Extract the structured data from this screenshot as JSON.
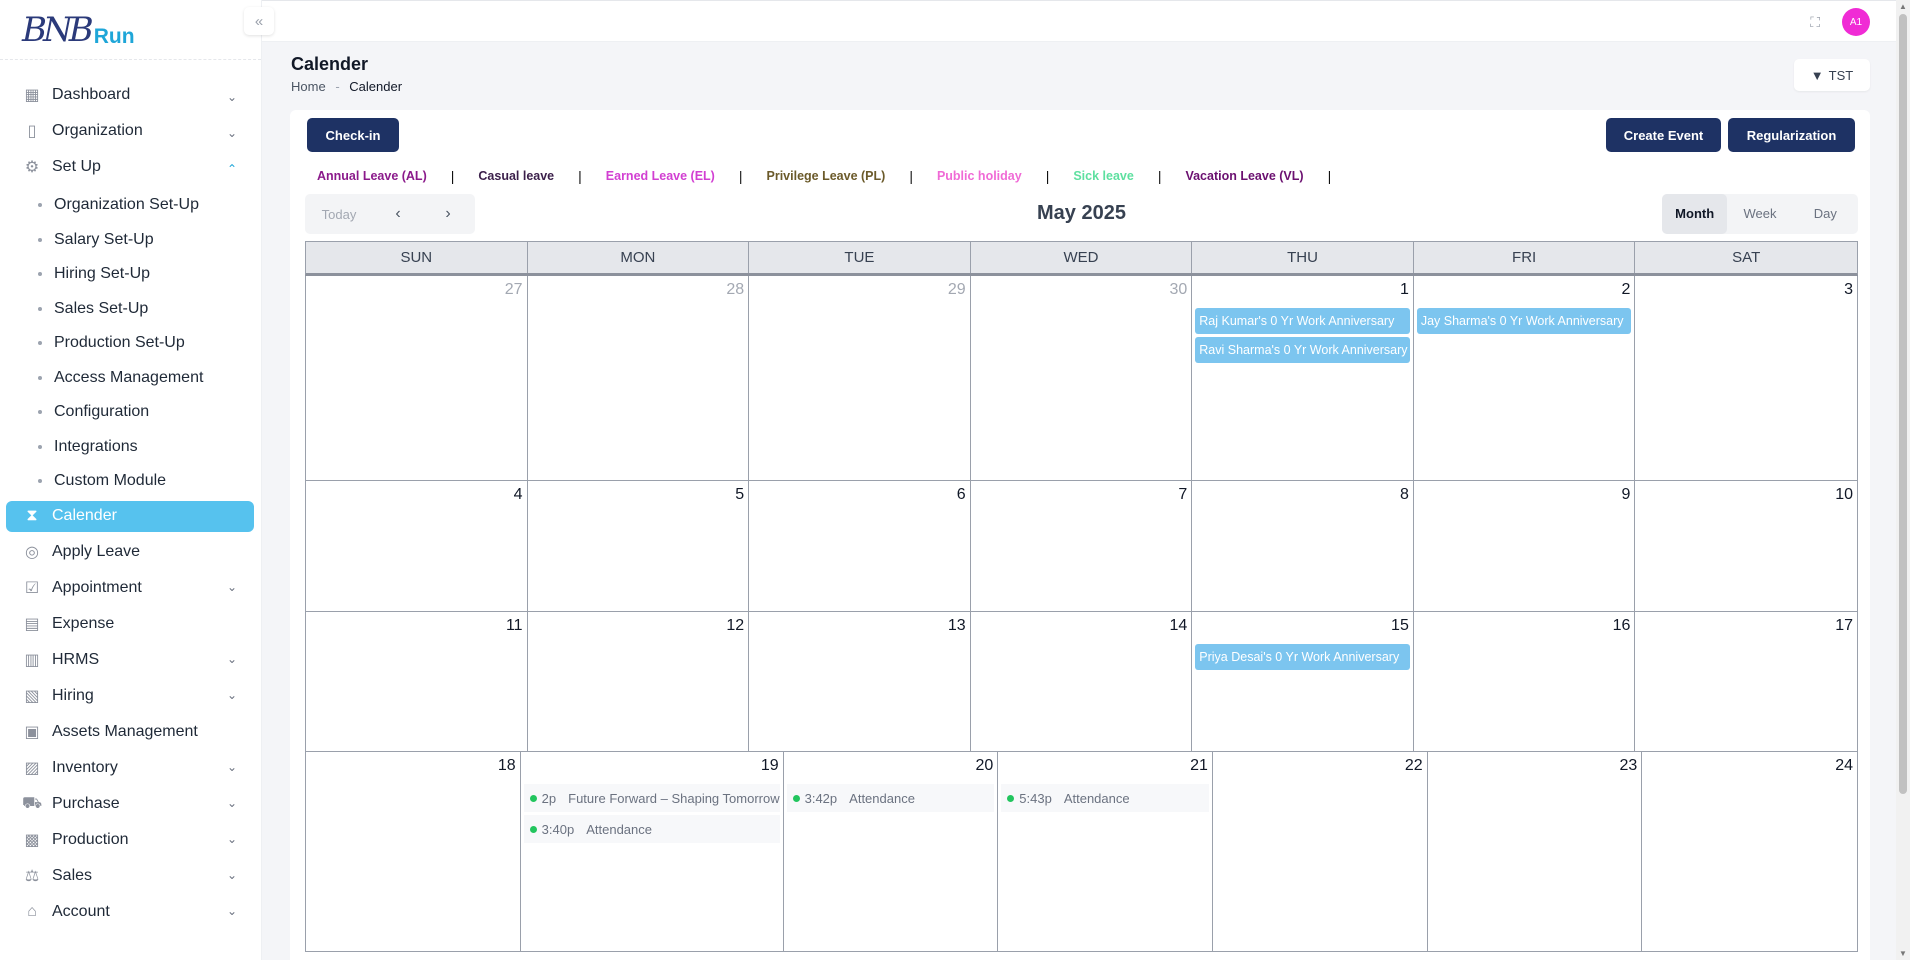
{
  "brand": {
    "logo_mark": "BNB",
    "logo_word": "Run"
  },
  "sidebar": {
    "items": [
      {
        "label": "Dashboard",
        "icon": "dashboard-icon",
        "chevron": "down"
      },
      {
        "label": "Organization",
        "icon": "document-icon",
        "chevron": "down"
      },
      {
        "label": "Set Up",
        "icon": "setup-gear-icon",
        "chevron": "up"
      }
    ],
    "setup_sub": [
      "Organization Set-Up",
      "Salary Set-Up",
      "Hiring Set-Up",
      "Sales Set-Up",
      "Production Set-Up",
      "Access Management",
      "Configuration",
      "Integrations",
      "Custom Module"
    ],
    "items_after": [
      {
        "label": "Calender",
        "icon": "hourglass-icon",
        "active": true
      },
      {
        "label": "Apply Leave",
        "icon": "lifebuoy-icon"
      },
      {
        "label": "Appointment",
        "icon": "calendar-check-icon",
        "chevron": "down"
      },
      {
        "label": "Expense",
        "icon": "expense-icon"
      },
      {
        "label": "HRMS",
        "icon": "hrms-icon",
        "chevron": "down"
      },
      {
        "label": "Hiring",
        "icon": "hiring-icon",
        "chevron": "down"
      },
      {
        "label": "Assets Management",
        "icon": "assets-icon"
      },
      {
        "label": "Inventory",
        "icon": "inventory-icon",
        "chevron": "down"
      },
      {
        "label": "Purchase",
        "icon": "cart-icon",
        "chevron": "down"
      },
      {
        "label": "Production",
        "icon": "factory-icon",
        "chevron": "down"
      },
      {
        "label": "Sales",
        "icon": "scale-icon",
        "chevron": "down"
      },
      {
        "label": "Account",
        "icon": "bank-icon",
        "chevron": "down"
      }
    ]
  },
  "topbar": {
    "avatar_initials": "A1"
  },
  "page": {
    "title": "Calender",
    "breadcrumb_home": "Home",
    "breadcrumb_sep": "-",
    "breadcrumb_current": "Calender",
    "filter_label": "TST"
  },
  "actions": {
    "checkin": "Check-in",
    "create_event": "Create Event",
    "regularization": "Regularization"
  },
  "legend": [
    {
      "label": "Annual Leave (AL)",
      "color": "#8b1a8b"
    },
    {
      "label": "Casual leave",
      "color": "#3b1f4a"
    },
    {
      "label": "Earned Leave (EL)",
      "color": "#d23fd2"
    },
    {
      "label": "Privilege Leave (PL)",
      "color": "#6b5a2a"
    },
    {
      "label": "Public holiday",
      "color": "#f06ad6"
    },
    {
      "label": "Sick leave",
      "color": "#5ee0a0"
    },
    {
      "label": "Vacation Leave (VL)",
      "color": "#6b1070"
    }
  ],
  "calendar": {
    "today_label": "Today",
    "month_title": "May 2025",
    "views": [
      "Month",
      "Week",
      "Day"
    ],
    "active_view": "Month",
    "days_of_week": [
      "SUN",
      "MON",
      "TUE",
      "WED",
      "THU",
      "FRI",
      "SAT"
    ],
    "weeks": [
      [
        {
          "d": "27",
          "muted": true
        },
        {
          "d": "28",
          "muted": true
        },
        {
          "d": "29",
          "muted": true
        },
        {
          "d": "30",
          "muted": true
        },
        {
          "d": "1",
          "pills": [
            "Raj Kumar's 0 Yr Work Anniversary",
            "Ravi Sharma's 0 Yr Work Anniversary"
          ]
        },
        {
          "d": "2",
          "pills": [
            "Jay Sharma's 0 Yr Work Anniversary"
          ]
        },
        {
          "d": "3"
        }
      ],
      [
        {
          "d": "4"
        },
        {
          "d": "5"
        },
        {
          "d": "6"
        },
        {
          "d": "7"
        },
        {
          "d": "8"
        },
        {
          "d": "9"
        },
        {
          "d": "10"
        }
      ],
      [
        {
          "d": "11"
        },
        {
          "d": "12"
        },
        {
          "d": "13"
        },
        {
          "d": "14"
        },
        {
          "d": "15",
          "pills": [
            "Priya Desai's 0 Yr Work Anniversary"
          ]
        },
        {
          "d": "16"
        },
        {
          "d": "17"
        }
      ],
      [
        {
          "d": "18"
        },
        {
          "d": "19",
          "dots": [
            {
              "time": "2p",
              "title": "Future Forward – Shaping Tomorrow"
            },
            {
              "time": "3:40p",
              "title": "Attendance"
            }
          ]
        },
        {
          "d": "20",
          "dots": [
            {
              "time": "3:42p",
              "title": "Attendance"
            }
          ]
        },
        {
          "d": "21",
          "dots": [
            {
              "time": "5:43p",
              "title": "Attendance"
            }
          ]
        },
        {
          "d": "22"
        },
        {
          "d": "23"
        },
        {
          "d": "24"
        }
      ]
    ]
  }
}
